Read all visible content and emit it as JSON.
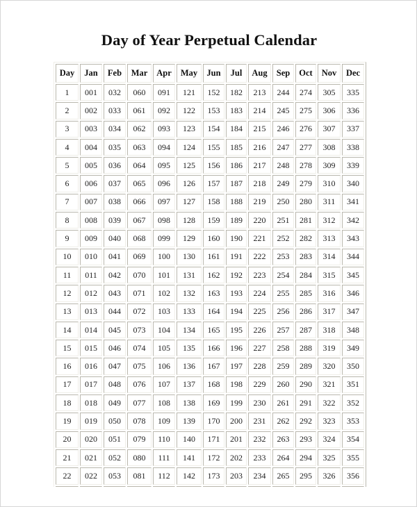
{
  "title": "Day of Year Perpetual Calendar",
  "table": {
    "headers": [
      "Day",
      "Jan",
      "Feb",
      "Mar",
      "Apr",
      "May",
      "Jun",
      "Jul",
      "Aug",
      "Sep",
      "Oct",
      "Nov",
      "Dec"
    ],
    "rows": [
      [
        "1",
        "001",
        "032",
        "060",
        "091",
        "121",
        "152",
        "182",
        "213",
        "244",
        "274",
        "305",
        "335"
      ],
      [
        "2",
        "002",
        "033",
        "061",
        "092",
        "122",
        "153",
        "183",
        "214",
        "245",
        "275",
        "306",
        "336"
      ],
      [
        "3",
        "003",
        "034",
        "062",
        "093",
        "123",
        "154",
        "184",
        "215",
        "246",
        "276",
        "307",
        "337"
      ],
      [
        "4",
        "004",
        "035",
        "063",
        "094",
        "124",
        "155",
        "185",
        "216",
        "247",
        "277",
        "308",
        "338"
      ],
      [
        "5",
        "005",
        "036",
        "064",
        "095",
        "125",
        "156",
        "186",
        "217",
        "248",
        "278",
        "309",
        "339"
      ],
      [
        "6",
        "006",
        "037",
        "065",
        "096",
        "126",
        "157",
        "187",
        "218",
        "249",
        "279",
        "310",
        "340"
      ],
      [
        "7",
        "007",
        "038",
        "066",
        "097",
        "127",
        "158",
        "188",
        "219",
        "250",
        "280",
        "311",
        "341"
      ],
      [
        "8",
        "008",
        "039",
        "067",
        "098",
        "128",
        "159",
        "189",
        "220",
        "251",
        "281",
        "312",
        "342"
      ],
      [
        "9",
        "009",
        "040",
        "068",
        "099",
        "129",
        "160",
        "190",
        "221",
        "252",
        "282",
        "313",
        "343"
      ],
      [
        "10",
        "010",
        "041",
        "069",
        "100",
        "130",
        "161",
        "191",
        "222",
        "253",
        "283",
        "314",
        "344"
      ],
      [
        "11",
        "011",
        "042",
        "070",
        "101",
        "131",
        "162",
        "192",
        "223",
        "254",
        "284",
        "315",
        "345"
      ],
      [
        "12",
        "012",
        "043",
        "071",
        "102",
        "132",
        "163",
        "193",
        "224",
        "255",
        "285",
        "316",
        "346"
      ],
      [
        "13",
        "013",
        "044",
        "072",
        "103",
        "133",
        "164",
        "194",
        "225",
        "256",
        "286",
        "317",
        "347"
      ],
      [
        "14",
        "014",
        "045",
        "073",
        "104",
        "134",
        "165",
        "195",
        "226",
        "257",
        "287",
        "318",
        "348"
      ],
      [
        "15",
        "015",
        "046",
        "074",
        "105",
        "135",
        "166",
        "196",
        "227",
        "258",
        "288",
        "319",
        "349"
      ],
      [
        "16",
        "016",
        "047",
        "075",
        "106",
        "136",
        "167",
        "197",
        "228",
        "259",
        "289",
        "320",
        "350"
      ],
      [
        "17",
        "017",
        "048",
        "076",
        "107",
        "137",
        "168",
        "198",
        "229",
        "260",
        "290",
        "321",
        "351"
      ],
      [
        "18",
        "018",
        "049",
        "077",
        "108",
        "138",
        "169",
        "199",
        "230",
        "261",
        "291",
        "322",
        "352"
      ],
      [
        "19",
        "019",
        "050",
        "078",
        "109",
        "139",
        "170",
        "200",
        "231",
        "262",
        "292",
        "323",
        "353"
      ],
      [
        "20",
        "020",
        "051",
        "079",
        "110",
        "140",
        "171",
        "201",
        "232",
        "263",
        "293",
        "324",
        "354"
      ],
      [
        "21",
        "021",
        "052",
        "080",
        "111",
        "141",
        "172",
        "202",
        "233",
        "264",
        "294",
        "325",
        "355"
      ],
      [
        "22",
        "022",
        "053",
        "081",
        "112",
        "142",
        "173",
        "203",
        "234",
        "265",
        "295",
        "326",
        "356"
      ],
      [
        "",
        "",
        "",
        "",
        "",
        "",
        "",
        "",
        "",
        "",
        "",
        "",
        ""
      ]
    ]
  },
  "colors": {
    "text": "#222222",
    "cell_border_dark": "#b9b7ad",
    "cell_border_light": "#efeee8",
    "page_border": "#d6d6d6"
  }
}
